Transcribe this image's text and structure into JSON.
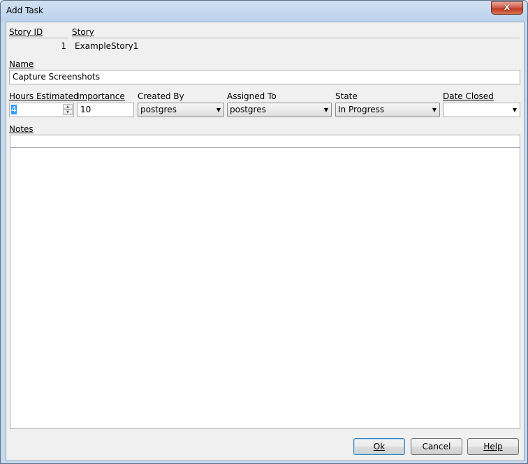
{
  "window": {
    "title": "Add Task",
    "close_symbol": "x"
  },
  "story": {
    "id_label": "Story ID",
    "id_value": "1",
    "story_label": "Story",
    "story_value": "ExampleStory1"
  },
  "name": {
    "label": "Name",
    "value": "Capture Screenshots"
  },
  "fields": {
    "hours_label": "Hours Estimated",
    "hours_value": "4",
    "importance_label": "Importance",
    "importance_value": "10",
    "created_by_label": "Created By",
    "created_by_value": "postgres",
    "assigned_to_label": "Assigned To",
    "assigned_to_value": "postgres",
    "state_label": "State",
    "state_value": "In Progress",
    "date_closed_label": "Date Closed",
    "date_closed_value": ""
  },
  "notes": {
    "label": "Notes",
    "value": ""
  },
  "buttons": {
    "ok": "Ok",
    "cancel": "Cancel",
    "help": "Help"
  },
  "icons": {
    "dropdown": "dropdown-arrow-icon",
    "spin_up": "spin-up-icon",
    "spin_down": "spin-down-icon",
    "close": "close-icon"
  }
}
